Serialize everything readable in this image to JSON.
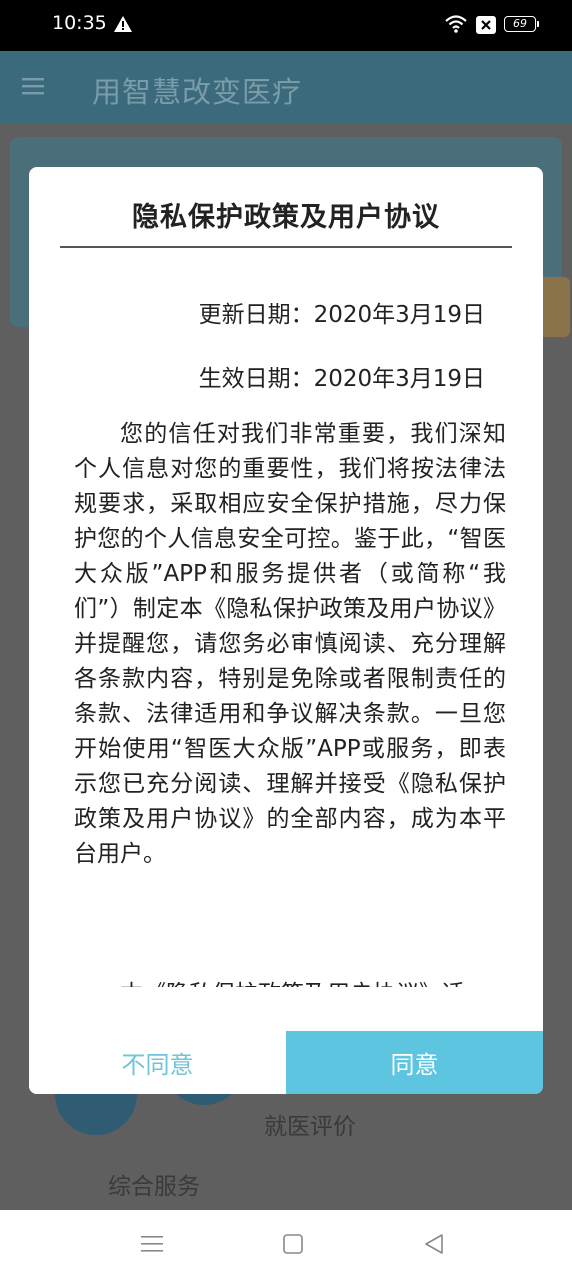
{
  "status_bar": {
    "time": "10:35",
    "battery": "69",
    "icons": [
      "warning-icon",
      "wifi-icon",
      "sim-icon",
      "battery-icon"
    ]
  },
  "app": {
    "title": "用智慧改变医疗",
    "background_labels": [
      "就医评价",
      "综合服务"
    ],
    "header_color": "#3b6a7d"
  },
  "dialog": {
    "title": "隐私保护政策及用户协议",
    "update_date_label": "更新日期：",
    "update_date": "2020年3月19日",
    "effective_date_label": "生效日期：",
    "effective_date": "2020年3月19日",
    "paragraph_1": "您的信任对我们非常重要，我们深知个人信息对您的重要性，我们将按法律法规要求，采取相应安全保护措施，尽力保护您的个人信息安全可控。鉴于此，“智医大众版”APP和服务提供者（或简称“我们”）制定本《隐私保护政策及用户协议》并提醒您，请您务必审慎阅读、充分理解各条款内容，特别是免除或者限制责任的条款、法律适用和争议解决条款。一旦您开始使用“智医大众版”APP或服务，即表示您已充分阅读、理解并接受《隐私保护政策及用户协议》的全部内容，成为本平台用户。",
    "paragraph_2_partial": "本《隐私保护政策及用户协议》适",
    "disagree_label": "不同意",
    "agree_label": "同意",
    "accent_color": "#5ec5e0"
  }
}
